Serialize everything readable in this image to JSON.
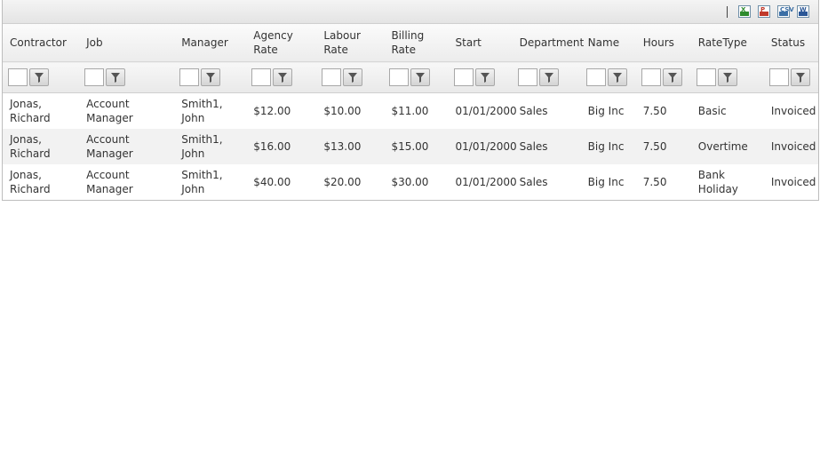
{
  "toolbar": {
    "exports": [
      {
        "name": "excel-export-icon",
        "label": "X",
        "color": "#2e8b2e"
      },
      {
        "name": "pdf-export-icon",
        "label": "P",
        "color": "#c0392b"
      },
      {
        "name": "csv-export-icon",
        "label": "CSV",
        "color": "#3a6ea5"
      },
      {
        "name": "word-export-icon",
        "label": "W",
        "color": "#2b5797"
      }
    ]
  },
  "columns": [
    {
      "key": "contractor",
      "label": "Contractor"
    },
    {
      "key": "job",
      "label": "Job"
    },
    {
      "key": "manager",
      "label": "Manager"
    },
    {
      "key": "agency_rate",
      "label": "Agency Rate"
    },
    {
      "key": "labour_rate",
      "label": "Labour Rate"
    },
    {
      "key": "billing_rate",
      "label": "Billing Rate"
    },
    {
      "key": "start",
      "label": "Start"
    },
    {
      "key": "department",
      "label": "Department"
    },
    {
      "key": "name",
      "label": "Name"
    },
    {
      "key": "hours",
      "label": "Hours"
    },
    {
      "key": "ratetype",
      "label": "RateType"
    },
    {
      "key": "status",
      "label": "Status"
    }
  ],
  "rows": [
    [
      "Jonas, Richard",
      "Account Manager",
      "Smith1, John",
      "$12.00",
      "$10.00",
      "$11.00",
      "01/01/2000",
      "Sales",
      "Big Inc",
      "7.50",
      "Basic",
      "Invoiced"
    ],
    [
      "Jonas, Richard",
      "Account Manager",
      "Smith1, John",
      "$16.00",
      "$13.00",
      "$15.00",
      "01/01/2000",
      "Sales",
      "Big Inc",
      "7.50",
      "Overtime",
      "Invoiced"
    ],
    [
      "Jonas, Richard",
      "Account Manager",
      "Smith1, John",
      "$40.00",
      "$20.00",
      "$30.00",
      "01/01/2000",
      "Sales",
      "Big Inc",
      "7.50",
      "Bank Holiday",
      "Invoiced"
    ]
  ]
}
